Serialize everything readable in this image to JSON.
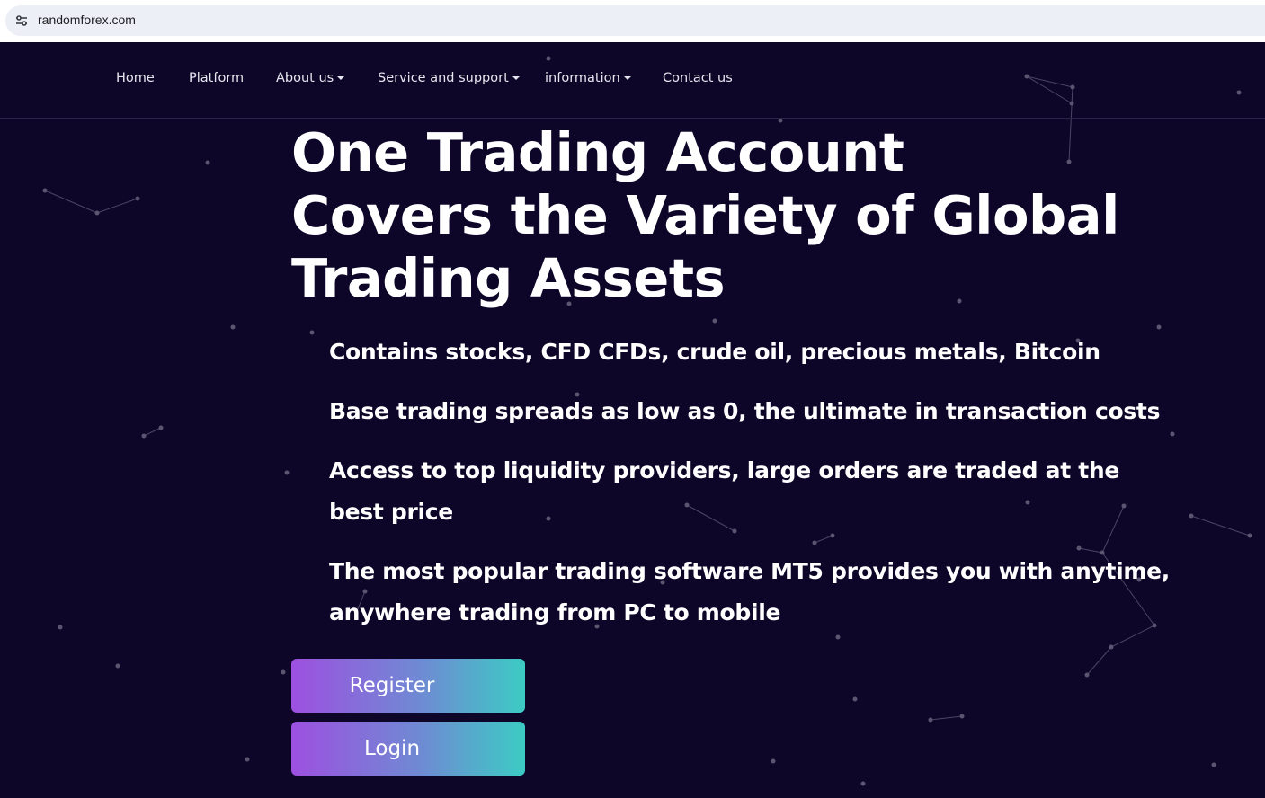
{
  "browser": {
    "url": "randomforex.com",
    "site_info_icon": "tune-icon"
  },
  "nav": {
    "items": [
      {
        "label": "Home",
        "dropdown": false
      },
      {
        "label": "Platform",
        "dropdown": false
      },
      {
        "label": "About us",
        "dropdown": true
      },
      {
        "label": "Service and support",
        "dropdown": true
      },
      {
        "label": "information",
        "dropdown": true
      },
      {
        "label": "Contact us",
        "dropdown": false
      }
    ]
  },
  "hero": {
    "title_lines": [
      "One Trading Account",
      "Covers the Variety of Global",
      "Trading Assets"
    ],
    "features": [
      "Contains stocks, CFD CFDs, crude oil, precious metals, Bitcoin",
      "Base trading spreads as low as 0, the ultimate in transaction costs",
      "Access to top liquidity providers, large orders are traded at the best price",
      "The most popular trading software MT5 provides you with anytime, anywhere trading from PC to mobile"
    ],
    "register_label": "Register",
    "login_label": "Login"
  },
  "colors": {
    "background": "#0d0628",
    "text": "#ffffff",
    "button_gradient_start": "#9d50e0",
    "button_gradient_end": "#3ccbc4",
    "star": "#5a5570"
  }
}
